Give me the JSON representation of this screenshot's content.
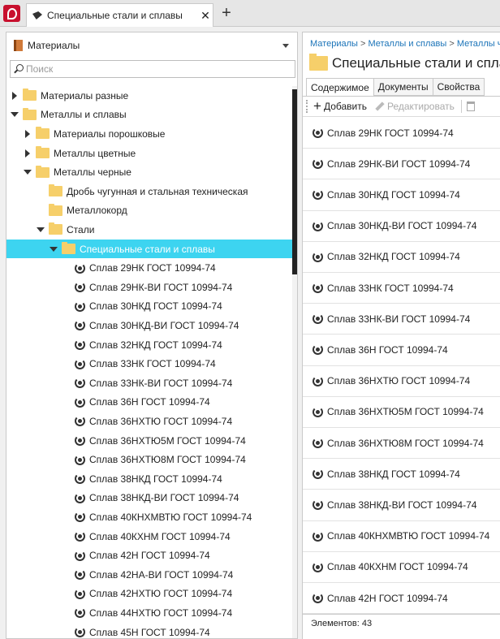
{
  "tabbar": {
    "active_tab_title": "Специальные стали и сплавы",
    "close_glyph": "✕",
    "add_glyph": "+"
  },
  "left_panel": {
    "library_label": "Материалы",
    "search_placeholder": "Поиск",
    "tree": [
      {
        "label": "Материалы разные",
        "level": 0,
        "expander": "closed",
        "icon": "folder-icon"
      },
      {
        "label": "Металлы и сплавы",
        "level": 0,
        "expander": "open",
        "icon": "folder-icon"
      },
      {
        "label": "Материалы порошковые",
        "level": 1,
        "expander": "closed",
        "icon": "folder-icon"
      },
      {
        "label": "Металлы цветные",
        "level": 1,
        "expander": "closed",
        "icon": "folder-icon"
      },
      {
        "label": "Металлы черные",
        "level": 1,
        "expander": "open",
        "icon": "folder-icon"
      },
      {
        "label": "Дробь чугунная и стальная техническая",
        "level": 2,
        "expander": "none",
        "icon": "folder-icon"
      },
      {
        "label": "Металлокорд",
        "level": 2,
        "expander": "none",
        "icon": "folder-icon"
      },
      {
        "label": "Стали",
        "level": 2,
        "expander": "open",
        "icon": "folder-icon"
      },
      {
        "label": "Специальные стали и сплавы",
        "level": 3,
        "expander": "open",
        "icon": "folder-icon",
        "selected": true
      },
      {
        "label": "Сплав 29НК ГОСТ 10994-74",
        "level": 4,
        "expander": "none",
        "icon": "material-icon"
      },
      {
        "label": "Сплав 29НК-ВИ ГОСТ 10994-74",
        "level": 4,
        "expander": "none",
        "icon": "material-icon"
      },
      {
        "label": "Сплав 30НКД ГОСТ 10994-74",
        "level": 4,
        "expander": "none",
        "icon": "material-icon"
      },
      {
        "label": "Сплав 30НКД-ВИ ГОСТ 10994-74",
        "level": 4,
        "expander": "none",
        "icon": "material-icon"
      },
      {
        "label": "Сплав 32НКД ГОСТ 10994-74",
        "level": 4,
        "expander": "none",
        "icon": "material-icon"
      },
      {
        "label": "Сплав 33НК ГОСТ 10994-74",
        "level": 4,
        "expander": "none",
        "icon": "material-icon"
      },
      {
        "label": "Сплав 33НК-ВИ ГОСТ 10994-74",
        "level": 4,
        "expander": "none",
        "icon": "material-icon"
      },
      {
        "label": "Сплав 36Н ГОСТ 10994-74",
        "level": 4,
        "expander": "none",
        "icon": "material-icon"
      },
      {
        "label": "Сплав 36НХТЮ ГОСТ 10994-74",
        "level": 4,
        "expander": "none",
        "icon": "material-icon"
      },
      {
        "label": "Сплав 36НХТЮ5М ГОСТ 10994-74",
        "level": 4,
        "expander": "none",
        "icon": "material-icon"
      },
      {
        "label": "Сплав 36НХТЮ8М ГОСТ 10994-74",
        "level": 4,
        "expander": "none",
        "icon": "material-icon"
      },
      {
        "label": "Сплав 38НКД ГОСТ 10994-74",
        "level": 4,
        "expander": "none",
        "icon": "material-icon"
      },
      {
        "label": "Сплав 38НКД-ВИ ГОСТ 10994-74",
        "level": 4,
        "expander": "none",
        "icon": "material-icon"
      },
      {
        "label": "Сплав 40КНХМВТЮ ГОСТ 10994-74",
        "level": 4,
        "expander": "none",
        "icon": "material-icon"
      },
      {
        "label": "Сплав 40КХНМ ГОСТ 10994-74",
        "level": 4,
        "expander": "none",
        "icon": "material-icon"
      },
      {
        "label": "Сплав 42Н ГОСТ 10994-74",
        "level": 4,
        "expander": "none",
        "icon": "material-icon"
      },
      {
        "label": "Сплав 42НА-ВИ ГОСТ 10994-74",
        "level": 4,
        "expander": "none",
        "icon": "material-icon"
      },
      {
        "label": "Сплав 42НХТЮ ГОСТ 10994-74",
        "level": 4,
        "expander": "none",
        "icon": "material-icon"
      },
      {
        "label": "Сплав 44НХТЮ ГОСТ 10994-74",
        "level": 4,
        "expander": "none",
        "icon": "material-icon"
      },
      {
        "label": "Сплав 45Н ГОСТ 10994-74",
        "level": 4,
        "expander": "none",
        "icon": "material-icon"
      }
    ]
  },
  "right_panel": {
    "breadcrumb": [
      "Материалы",
      "Металлы и сплавы",
      "Металлы черные"
    ],
    "breadcrumb_sep": " > ",
    "title": "Специальные стали и сплавы",
    "tabs": [
      "Содержимое",
      "Документы",
      "Свойства"
    ],
    "toolbar": {
      "add_label": "Добавить",
      "edit_label": "Редактировать"
    },
    "items": [
      "Сплав 29НК ГОСТ 10994-74",
      "Сплав 29НК-ВИ ГОСТ 10994-74",
      "Сплав 30НКД ГОСТ 10994-74",
      "Сплав 30НКД-ВИ ГОСТ 10994-74",
      "Сплав 32НКД ГОСТ 10994-74",
      "Сплав 33НК ГОСТ 10994-74",
      "Сплав 33НК-ВИ ГОСТ 10994-74",
      "Сплав 36Н ГОСТ 10994-74",
      "Сплав 36НХТЮ ГОСТ 10994-74",
      "Сплав 36НХТЮ5М ГОСТ 10994-74",
      "Сплав 36НХТЮ8М ГОСТ 10994-74",
      "Сплав 38НКД ГОСТ 10994-74",
      "Сплав 38НКД-ВИ ГОСТ 10994-74",
      "Сплав 40КНХМВТЮ ГОСТ 10994-74",
      "Сплав 40КХНМ ГОСТ 10994-74",
      "Сплав 42Н ГОСТ 10994-74"
    ],
    "status": "Элементов: 43"
  },
  "colors": {
    "selection": "#3dd4f0",
    "folder": "#f6cf6a",
    "brand": "#c8102e",
    "link": "#1a73b8"
  }
}
